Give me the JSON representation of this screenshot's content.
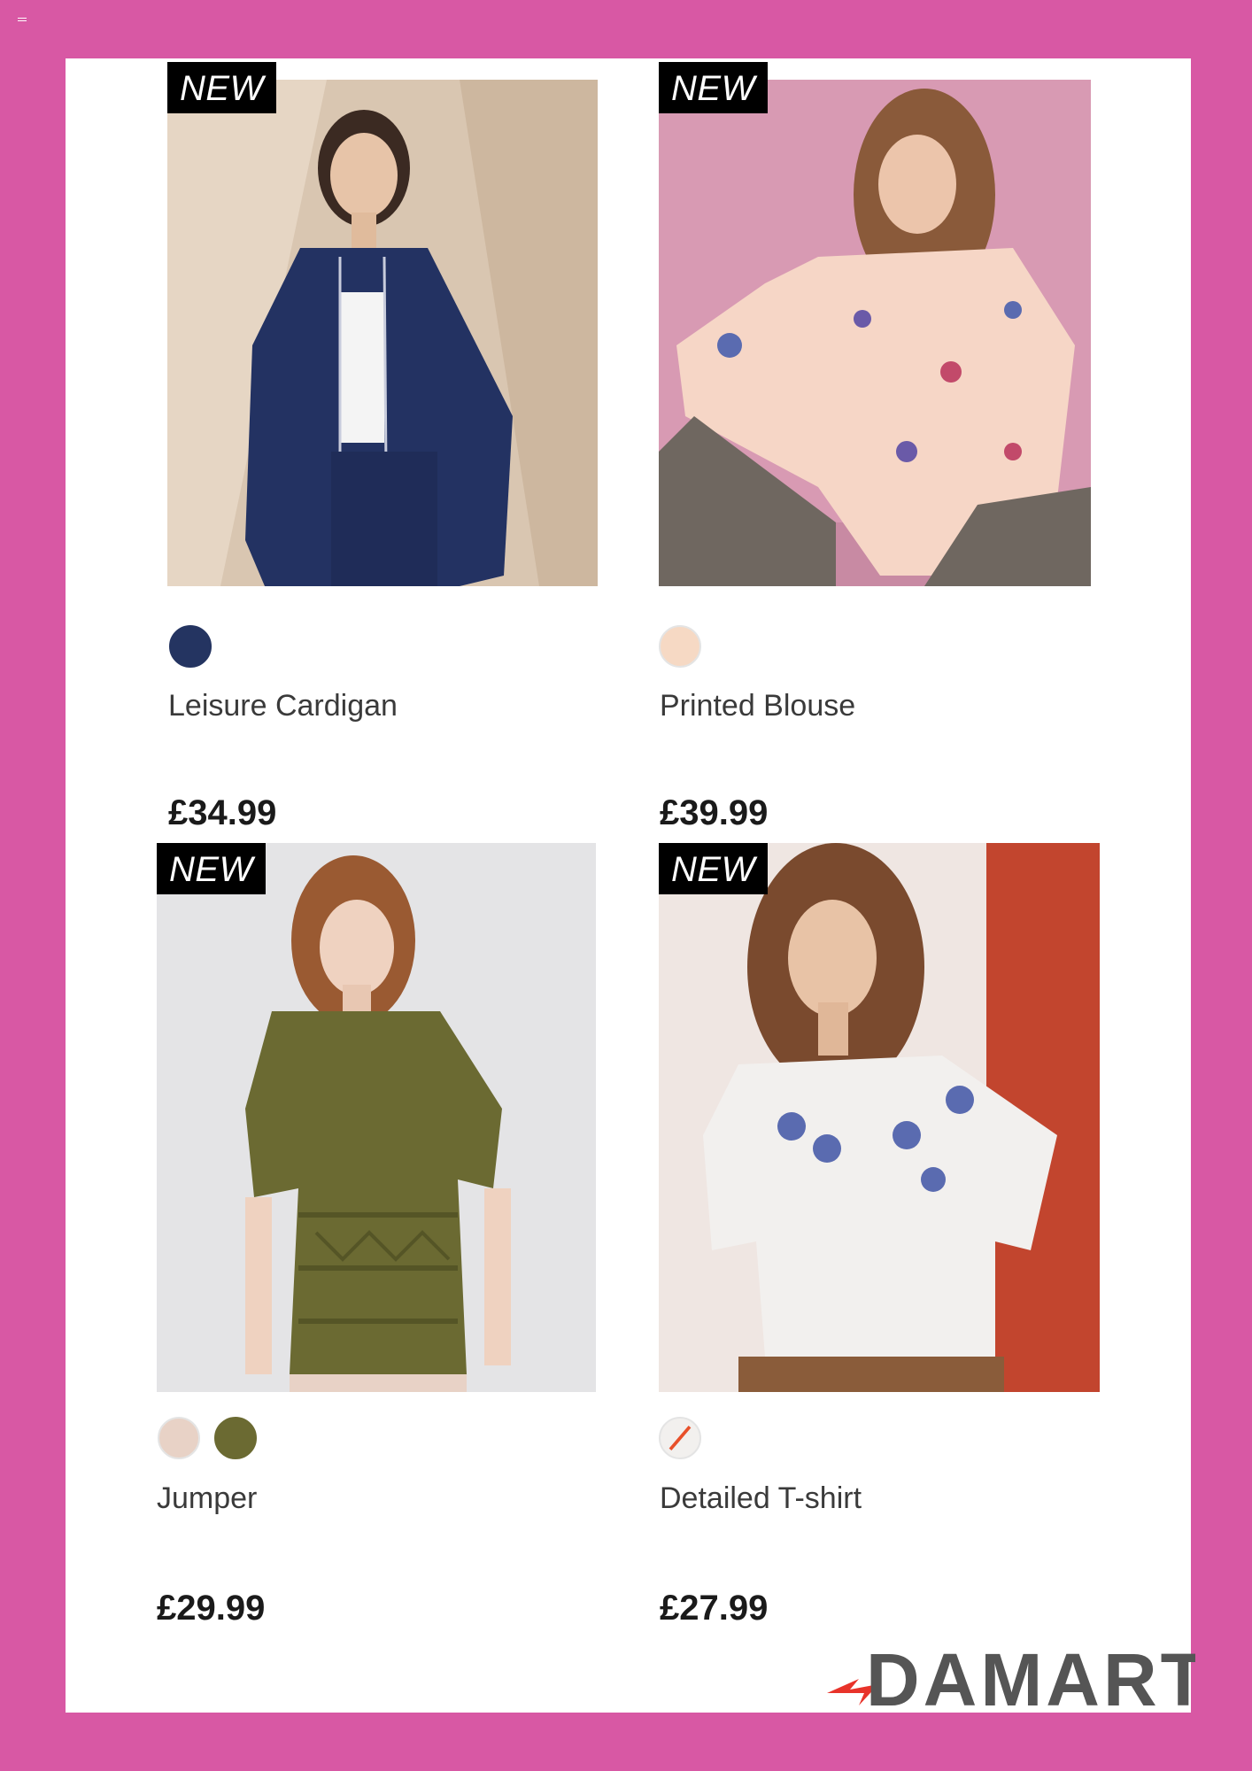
{
  "brand": {
    "logo_text": "DAMART"
  },
  "colors": {
    "frame": "#d858a4",
    "page": "#ffffff",
    "badge_bg": "#000000",
    "logo_accent": "#e8332a",
    "logo_text": "#555555"
  },
  "products": [
    {
      "badge": "NEW",
      "name": "Leisure Cardigan",
      "price": "£34.99",
      "swatches": [
        "#243461"
      ]
    },
    {
      "badge": "NEW",
      "name": "Printed Blouse",
      "price": "£39.99",
      "swatches": [
        "#f6d9c4"
      ]
    },
    {
      "badge": "NEW",
      "name": "Jumper",
      "price": "£29.99",
      "swatches": [
        "#e8d2c6",
        "#6b6a32"
      ]
    },
    {
      "badge": "NEW",
      "name": "Detailed T-shirt",
      "price": "£27.99",
      "swatches": [
        "#f2f0ee"
      ]
    }
  ]
}
